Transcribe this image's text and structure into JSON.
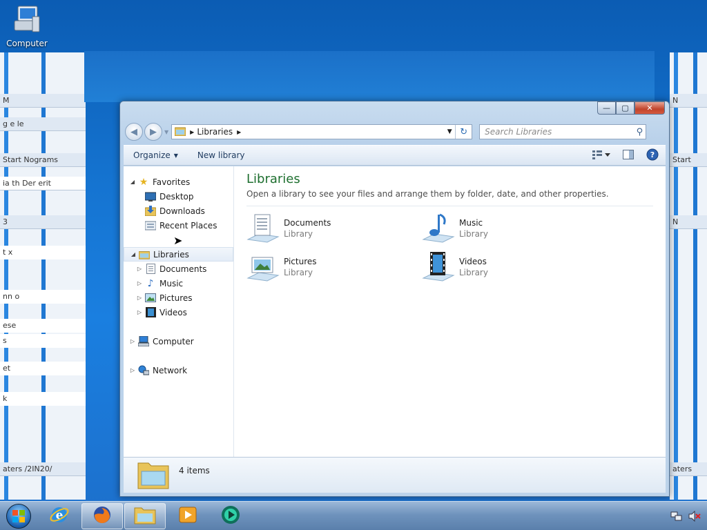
{
  "desktop": {
    "icons": [
      {
        "label": "Computer",
        "icon": "computer-icon"
      }
    ]
  },
  "background_windows": {
    "left_lines": [
      "M",
      "g  e le",
      "Start Nograms",
      "ia  th Der erit",
      "3",
      "t  x",
      "nn  o",
      "ese",
      "s",
      "et",
      "k",
      "aters  /2IN20/"
    ],
    "right_lines": [
      "N",
      "Start",
      "N",
      "aters"
    ]
  },
  "window": {
    "caption_buttons": {
      "minimize": "minimize-icon",
      "maximize": "maximize-icon",
      "close": "close-icon"
    },
    "address": {
      "crumbs": [
        "Libraries"
      ]
    },
    "search": {
      "placeholder": "Search Libraries"
    },
    "toolbar": {
      "organize": "Organize",
      "new_library": "New library"
    },
    "nav_pane": {
      "favorites": {
        "label": "Favorites",
        "items": [
          "Desktop",
          "Downloads",
          "Recent Places"
        ]
      },
      "libraries": {
        "label": "Libraries",
        "items": [
          "Documents",
          "Music",
          "Pictures",
          "Videos"
        ]
      },
      "computer": "Computer",
      "network": "Network"
    },
    "content": {
      "title": "Libraries",
      "subtitle": "Open a library to see your files and arrange them by folder, date, and other properties.",
      "libraries": [
        {
          "name": "Documents",
          "kind": "Library",
          "icon": "documents-library-icon"
        },
        {
          "name": "Music",
          "kind": "Library",
          "icon": "music-library-icon"
        },
        {
          "name": "Pictures",
          "kind": "Library",
          "icon": "pictures-library-icon"
        },
        {
          "name": "Videos",
          "kind": "Library",
          "icon": "videos-library-icon"
        }
      ]
    },
    "details": {
      "count": "4 items"
    }
  },
  "taskbar": {
    "buttons": [
      "start-orb",
      "internet-explorer-icon",
      "firefox-icon",
      "windows-explorer-icon",
      "media-player-icon",
      "app-icon"
    ],
    "tray": [
      "network-tray-icon",
      "volume-muted-icon"
    ]
  },
  "colors": {
    "heading_green": "#1e6f2f",
    "desktop_blue": "#1574d1",
    "window_chrome": "#c9dcef"
  }
}
